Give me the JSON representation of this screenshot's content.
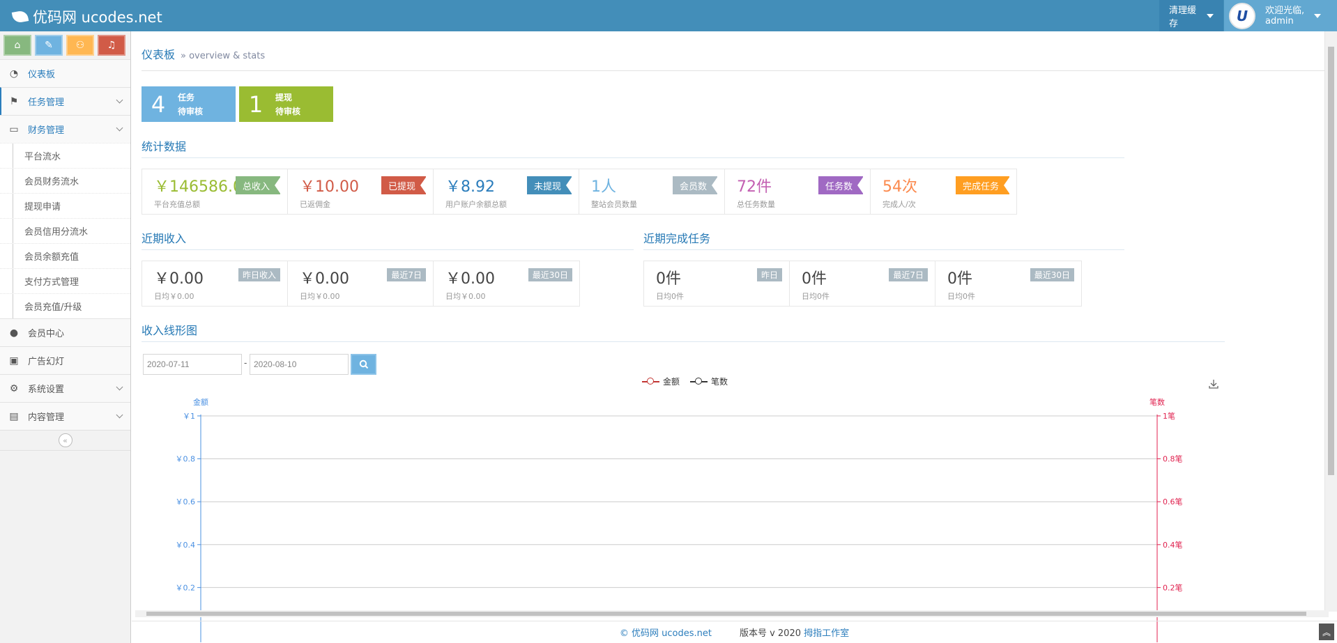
{
  "brand": {
    "name": "优码网 ucodes.net"
  },
  "navbar": {
    "clear_cache": "清理缓存",
    "welcome": "欢迎光临,",
    "username": "admin",
    "avatar_letter": "U"
  },
  "sidebar": {
    "shortcuts": [
      {
        "icon": "home-icon",
        "glyph": "⌂",
        "color": "#87b87f"
      },
      {
        "icon": "pencil-icon",
        "glyph": "✎",
        "color": "#6fb3e0"
      },
      {
        "icon": "users-icon",
        "glyph": "⚇",
        "color": "#ffb752"
      },
      {
        "icon": "bell-icon",
        "glyph": "♫",
        "color": "#d15b47"
      }
    ],
    "menu": [
      {
        "label": "仪表板",
        "icon": "dashboard-icon"
      },
      {
        "label": "任务管理",
        "icon": "flag-icon"
      },
      {
        "label": "财务管理",
        "icon": "inbox-icon"
      },
      {
        "label": "会员中心",
        "icon": "user-icon"
      },
      {
        "label": "广告幻灯",
        "icon": "picture-icon"
      },
      {
        "label": "系统设置",
        "icon": "gear-icon"
      },
      {
        "label": "内容管理",
        "icon": "book-icon"
      }
    ],
    "finance_sub": [
      "平台流水",
      "会员财务流水",
      "提现申请",
      "会员信用分流水",
      "会员余额充值",
      "支付方式管理",
      "会员充值/升级"
    ],
    "collapse": "«"
  },
  "page": {
    "title": "仪表板",
    "subtitle": "» overview & stats"
  },
  "infoboxes": [
    {
      "number": "4",
      "line1": "任务",
      "line2": "待审核",
      "color": "#6fb3e0"
    },
    {
      "number": "1",
      "line1": "提现",
      "line2": "待审核",
      "color": "#9abc32"
    }
  ],
  "stats": {
    "title": "统计数据",
    "items": [
      {
        "value": "￥146586.0",
        "label": "平台充值总额",
        "tag": "总收入",
        "color": "#9abc32",
        "tag_color": "#87b87f"
      },
      {
        "value": "￥10.00",
        "label": "已返佣金",
        "tag": "已提现",
        "color": "#d15b47",
        "tag_color": "#d15b47"
      },
      {
        "value": "￥8.92",
        "label": "用户账户余额总额",
        "tag": "未提现",
        "color": "#2b7dbc",
        "tag_color": "#438eb9"
      },
      {
        "value": "1人",
        "label": "整站会员数量",
        "tag": "会员数",
        "color": "#6fb3e0",
        "tag_color": "#abbac3"
      },
      {
        "value": "72件",
        "label": "总任务数量",
        "tag": "任务数",
        "color": "#c35fb2",
        "tag_color": "#a069c3"
      },
      {
        "value": "54次",
        "label": "完成人/次",
        "tag": "完成任务",
        "color": "#fb8a4e",
        "tag_color": "#ff9e21"
      }
    ]
  },
  "income": {
    "title": "近期收入",
    "items": [
      {
        "value": "￥0.00",
        "label": "日均￥0.00",
        "tag": "昨日收入"
      },
      {
        "value": "￥0.00",
        "label": "日均￥0.00",
        "tag": "最近7日"
      },
      {
        "value": "￥0.00",
        "label": "日均￥0.00",
        "tag": "最近30日"
      }
    ]
  },
  "tasks": {
    "title": "近期完成任务",
    "items": [
      {
        "value": "0件",
        "label": "日均0件",
        "tag": "昨日"
      },
      {
        "value": "0件",
        "label": "日均0件",
        "tag": "最近7日"
      },
      {
        "value": "0件",
        "label": "日均0件",
        "tag": "最近30日"
      }
    ]
  },
  "chart_section": {
    "title": "收入线形图",
    "date_from": "2020-07-11",
    "date_to": "2020-08-10",
    "separator": "-"
  },
  "chart_data": {
    "type": "line",
    "series": [
      {
        "name": "金额",
        "color": "#c23531",
        "values": []
      },
      {
        "name": "笔数",
        "color": "#333333",
        "values": []
      }
    ],
    "y_left": {
      "label": "金额",
      "ticks": [
        "￥1",
        "￥0.8",
        "￥0.6",
        "￥0.4",
        "￥0.2"
      ],
      "range": [
        0,
        1
      ],
      "color": "#4a90e2"
    },
    "y_right": {
      "label": "笔数",
      "ticks": [
        "1笔",
        "0.8笔",
        "0.6笔",
        "0.4笔",
        "0.2笔"
      ],
      "range": [
        0,
        1
      ],
      "color": "#e0224f"
    },
    "grid": true,
    "legend_position": "top-center"
  },
  "footer": {
    "copyright": "© 优码网 ucodes.net",
    "version": "版本号 v 2020",
    "studio": "拇指工作室"
  }
}
